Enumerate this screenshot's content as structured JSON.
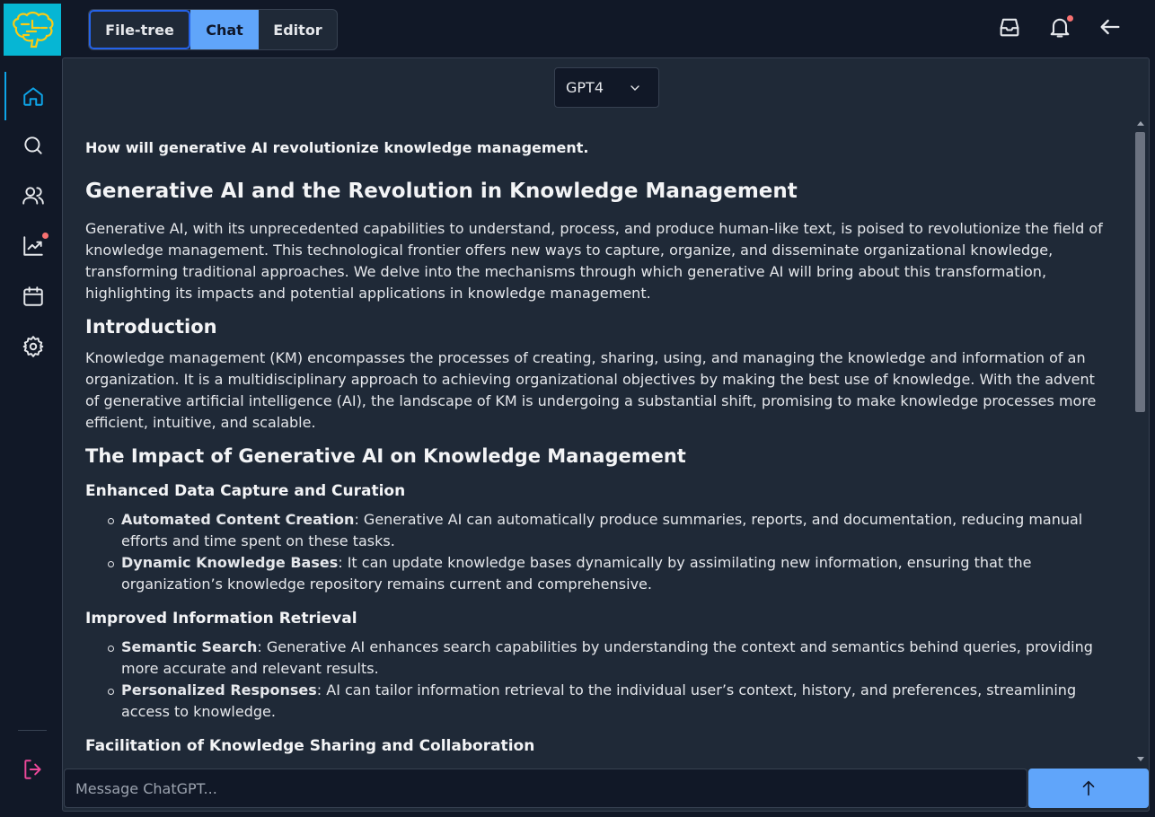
{
  "app": {
    "logo_icon": "brain-icon",
    "accent": "#60a5fa",
    "logo_bg": "#06b6d4"
  },
  "sidebar": {
    "items": [
      {
        "name": "home",
        "icon": "home-icon",
        "active": true
      },
      {
        "name": "search",
        "icon": "search-icon"
      },
      {
        "name": "users",
        "icon": "users-icon"
      },
      {
        "name": "analytics",
        "icon": "chart-line-icon",
        "notification": true
      },
      {
        "name": "calendar",
        "icon": "calendar-icon"
      },
      {
        "name": "settings",
        "icon": "gear-icon"
      }
    ],
    "logout_icon": "logout-icon"
  },
  "header": {
    "tabs": [
      {
        "label": "File-tree",
        "state": "focused"
      },
      {
        "label": "Chat",
        "state": "active"
      },
      {
        "label": "Editor",
        "state": "default"
      }
    ],
    "icons": [
      "inbox-icon",
      "bell-icon",
      "arrow-left-icon"
    ],
    "bell_notification": true
  },
  "chat": {
    "model": "GPT4",
    "prompt": "How will generative AI revolutionize knowledge management.",
    "title": "Generative AI and the Revolution in Knowledge Management",
    "intro_paragraph": "Generative AI, with its unprecedented capabilities to understand, process, and produce human-like text, is poised to revolutionize the field of knowledge management. This technological frontier offers new ways to capture, organize, and disseminate organizational knowledge, transforming traditional approaches. We delve into the mechanisms through which generative AI will bring about this transformation, highlighting its impacts and potential applications in knowledge management.",
    "section_intro": {
      "heading": "Introduction",
      "text": "Knowledge management (KM) encompasses the processes of creating, sharing, using, and managing the knowledge and information of an organization. It is a multidisciplinary approach to achieving organizational objectives by making the best use of knowledge. With the advent of generative artificial intelligence (AI), the landscape of KM is undergoing a substantial shift, promising to make knowledge processes more efficient, intuitive, and scalable."
    },
    "section_impact": {
      "heading": "The Impact of Generative AI on Knowledge Management",
      "sub1": {
        "heading": "Enhanced Data Capture and Curation",
        "items": [
          {
            "term": "Automated Content Creation",
            "text": ": Generative AI can automatically produce summaries, reports, and documentation, reducing manual efforts and time spent on these tasks."
          },
          {
            "term": "Dynamic Knowledge Bases",
            "text": ": It can update knowledge bases dynamically by assimilating new information, ensuring that the organization’s knowledge repository remains current and comprehensive."
          }
        ]
      },
      "sub2": {
        "heading": "Improved Information Retrieval",
        "items": [
          {
            "term": "Semantic Search",
            "text": ": Generative AI enhances search capabilities by understanding the context and semantics behind queries, providing more accurate and relevant results."
          },
          {
            "term": "Personalized Responses",
            "text": ": AI can tailor information retrieval to the individual user’s context, history, and preferences, streamlining access to knowledge."
          }
        ]
      },
      "sub3": {
        "heading": "Facilitation of Knowledge Sharing and Collaboration"
      }
    },
    "input_placeholder": "Message ChatGPT...",
    "send_icon": "arrow-up-icon"
  }
}
